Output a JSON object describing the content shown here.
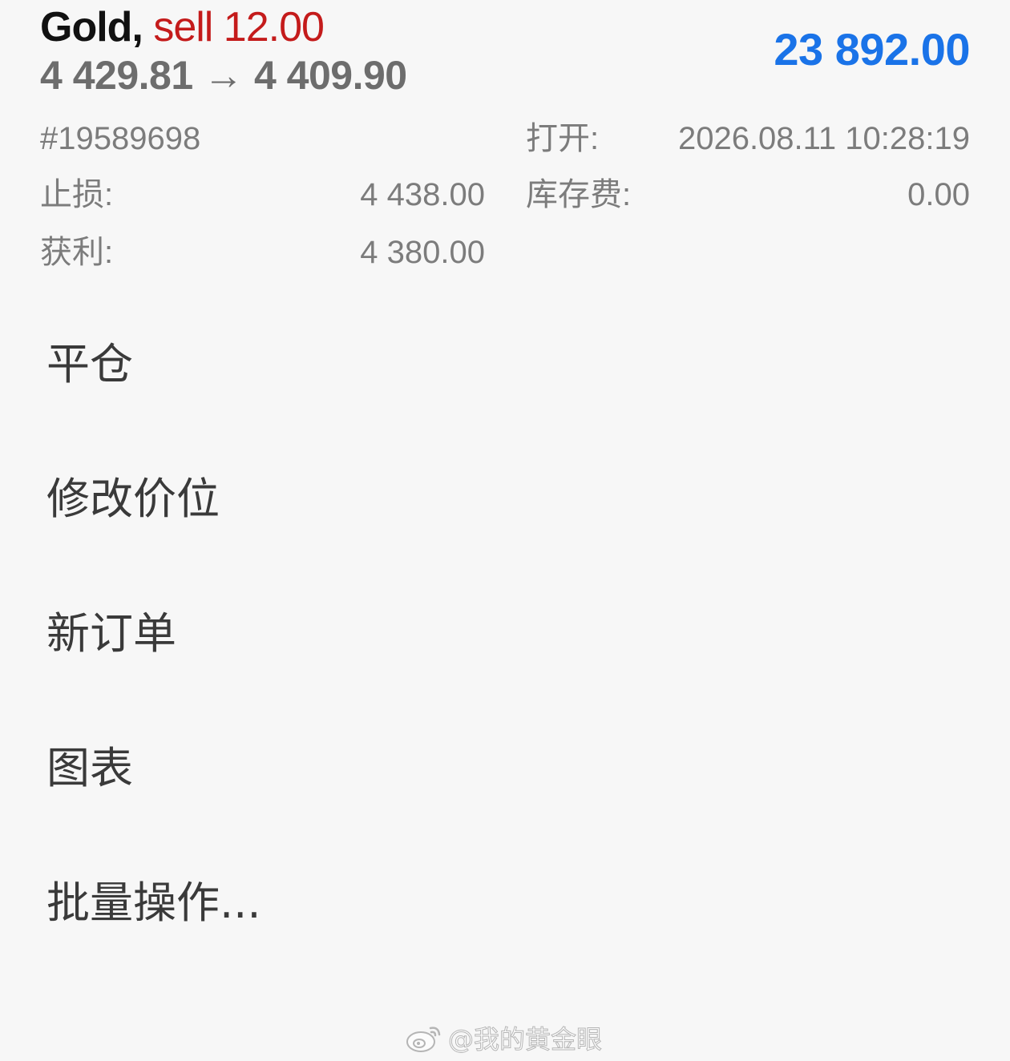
{
  "position": {
    "symbol": "Gold,",
    "trade": "sell 12.00",
    "open_price": "4 429.81",
    "arrow": "→",
    "current_price": "4 409.90",
    "profit": "23 892.00"
  },
  "details": {
    "ticket": "#19589698",
    "open_label": "打开:",
    "open_time": "2026.08.11 10:28:19",
    "sl_label": "止损:",
    "sl_value": "4 438.00",
    "swap_label": "库存费:",
    "swap_value": "0.00",
    "tp_label": "获利:",
    "tp_value": "4 380.00"
  },
  "menu": {
    "items": [
      {
        "label": "平仓"
      },
      {
        "label": "修改价位"
      },
      {
        "label": "新订单"
      },
      {
        "label": "图表"
      },
      {
        "label": "批量操作..."
      }
    ]
  },
  "watermark": {
    "text": "@我的黄金眼",
    "icon": "weibo-icon"
  },
  "colors": {
    "background": "#f7f7f7",
    "sell": "#c41b1b",
    "profit": "#1a73e8",
    "muted": "#7c7c7c"
  }
}
